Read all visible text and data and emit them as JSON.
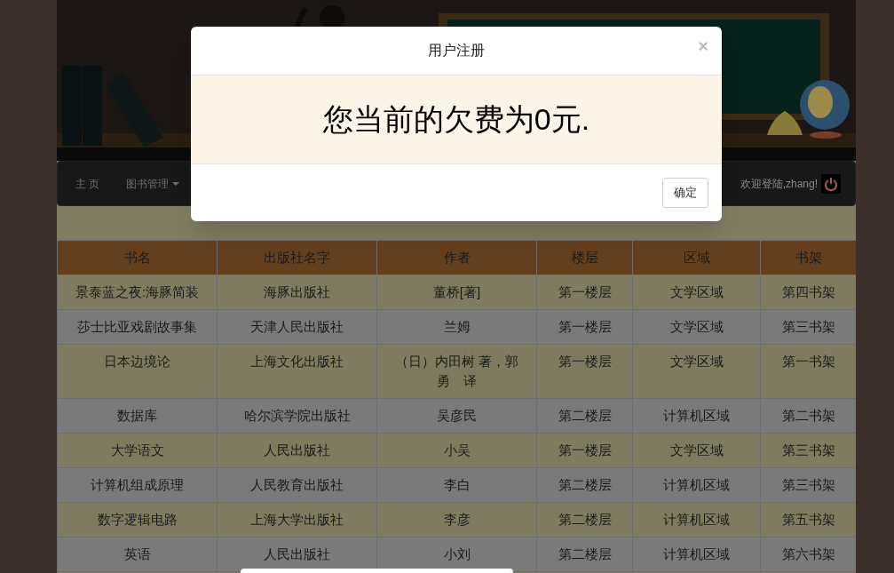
{
  "nav": {
    "items": [
      {
        "label": "主 页",
        "dropdown": false
      },
      {
        "label": "图书管理",
        "dropdown": true
      }
    ],
    "welcome": "欢迎登陆,zhang!"
  },
  "table": {
    "columns": [
      "书名",
      "出版社名字",
      "作者",
      "楼层",
      "区域",
      "书架"
    ],
    "rows": [
      [
        "景泰蓝之夜:海豚简装",
        "海豚出版社",
        "董桥[著]",
        "第一楼层",
        "文学区域",
        "第四书架"
      ],
      [
        "莎士比亚戏剧故事集",
        "天津人民出版社",
        "兰姆",
        "第一楼层",
        "文学区域",
        "第三书架"
      ],
      [
        "日本边境论",
        "上海文化出版社",
        "（日）内田树 著，郭勇　译",
        "第一楼层",
        "文学区域",
        "第一书架"
      ],
      [
        "数据库",
        "哈尔滨学院出版社",
        "吴彦民",
        "第二楼层",
        "计算机区域",
        "第二书架"
      ],
      [
        "大学语文",
        "人民出版社",
        "小吴",
        "第一楼层",
        "文学区域",
        "第三书架"
      ],
      [
        "计算机组成原理",
        "人民教育出版社",
        "李白",
        "第二楼层",
        "计算机区域",
        "第三书架"
      ],
      [
        "数字逻辑电路",
        "上海大学出版社",
        "李彦",
        "第二楼层",
        "计算机区域",
        "第五书架"
      ],
      [
        "英语",
        "人民出版社",
        "小刘",
        "第二楼层",
        "计算机区域",
        "第六书架"
      ]
    ]
  },
  "modal": {
    "title": "用户注册",
    "close": "×",
    "message": "您当前的欠费为0元.",
    "button": "确定"
  }
}
